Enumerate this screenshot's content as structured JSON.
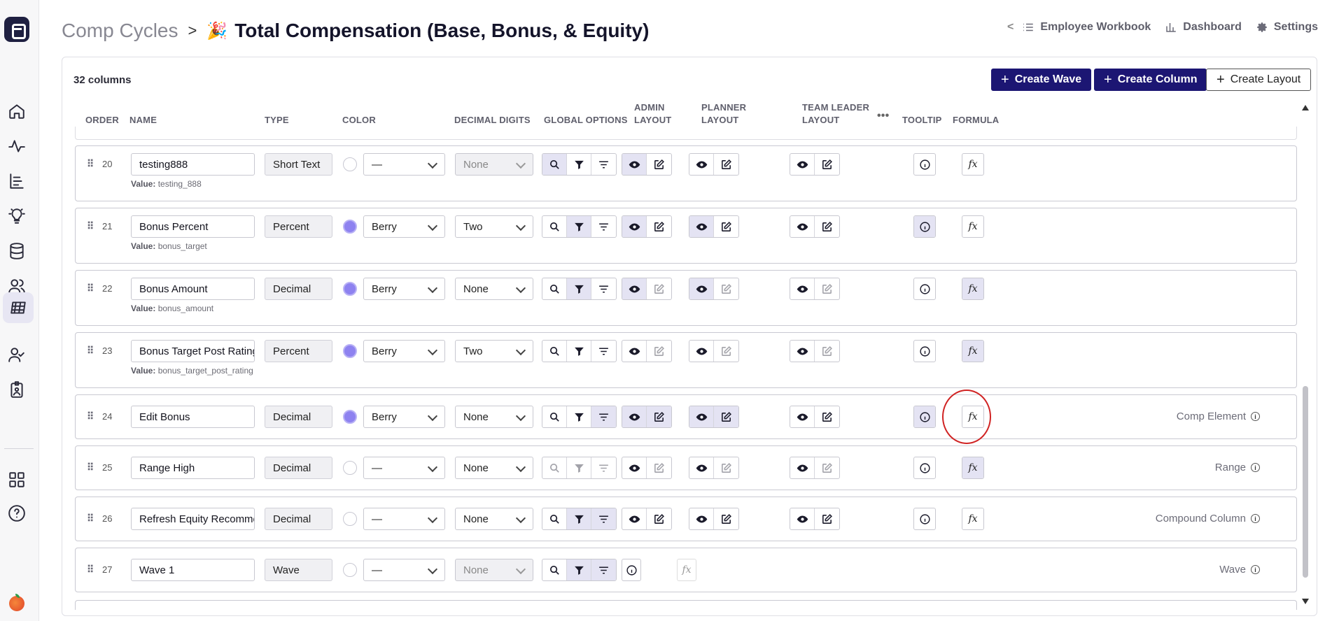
{
  "header": {
    "breadcrumb": "Comp Cycles",
    "separator": ">",
    "emoji": "🎉",
    "title": "Total Compensation (Base, Bonus, & Equity)"
  },
  "topnav": {
    "back_chevron": "<",
    "items": [
      {
        "label": "Employee Workbook",
        "icon": "list-icon"
      },
      {
        "label": "Dashboard",
        "icon": "bar-chart-icon"
      },
      {
        "label": "Settings",
        "icon": "gear-icon"
      }
    ]
  },
  "toolbar": {
    "count": "32 columns",
    "create_wave": "Create Wave",
    "create_column": "Create Column",
    "create_layout": "Create Layout"
  },
  "columns": {
    "order": "ORDER",
    "name": "NAME",
    "type": "TYPE",
    "color": "COLOR",
    "decimal": "DECIMAL DIGITS",
    "global": "GLOBAL OPTIONS",
    "admin1": "ADMIN",
    "admin2": "LAYOUT",
    "planner1": "PLANNER",
    "planner2": "LAYOUT",
    "team1": "TEAM LEADER",
    "team2": "LAYOUT",
    "more": "•••",
    "tooltip": "TOOLTIP",
    "formula": "FORMULA"
  },
  "rows": [
    {
      "order": "20",
      "name": "testing888",
      "type": "Short Text",
      "color": "—",
      "color_filled": false,
      "decimal": "None",
      "decimal_disabled": true,
      "value_prefix": "Value:",
      "value": "testing_888",
      "right_label": ""
    },
    {
      "order": "21",
      "name": "Bonus Percent",
      "type": "Percent",
      "color": "Berry",
      "color_filled": true,
      "decimal": "Two",
      "decimal_disabled": false,
      "value_prefix": "Value:",
      "value": "bonus_target",
      "right_label": ""
    },
    {
      "order": "22",
      "name": "Bonus Amount",
      "type": "Decimal",
      "color": "Berry",
      "color_filled": true,
      "decimal": "None",
      "decimal_disabled": false,
      "value_prefix": "Value:",
      "value": "bonus_amount",
      "right_label": ""
    },
    {
      "order": "23",
      "name": "Bonus Target Post Rating",
      "type": "Percent",
      "color": "Berry",
      "color_filled": true,
      "decimal": "Two",
      "decimal_disabled": false,
      "value_prefix": "Value:",
      "value": "bonus_target_post_rating",
      "right_label": ""
    },
    {
      "order": "24",
      "name": "Edit Bonus",
      "type": "Decimal",
      "color": "Berry",
      "color_filled": true,
      "decimal": "None",
      "decimal_disabled": false,
      "right_label": "Comp Element"
    },
    {
      "order": "25",
      "name": "Range High",
      "type": "Decimal",
      "color": "—",
      "color_filled": false,
      "decimal": "None",
      "decimal_disabled": false,
      "right_label": "Range"
    },
    {
      "order": "26",
      "name": "Refresh Equity Recommendation",
      "type": "Decimal",
      "color": "—",
      "color_filled": false,
      "decimal": "None",
      "decimal_disabled": false,
      "right_label": "Compound Column"
    },
    {
      "order": "27",
      "name": "Wave 1",
      "type": "Wave",
      "color": "—",
      "color_filled": false,
      "decimal": "None",
      "decimal_disabled": true,
      "right_label": "Wave"
    }
  ],
  "colors": {
    "primary": "#1c1673",
    "berry": "#8e82f0",
    "highlight": "#d02323"
  }
}
